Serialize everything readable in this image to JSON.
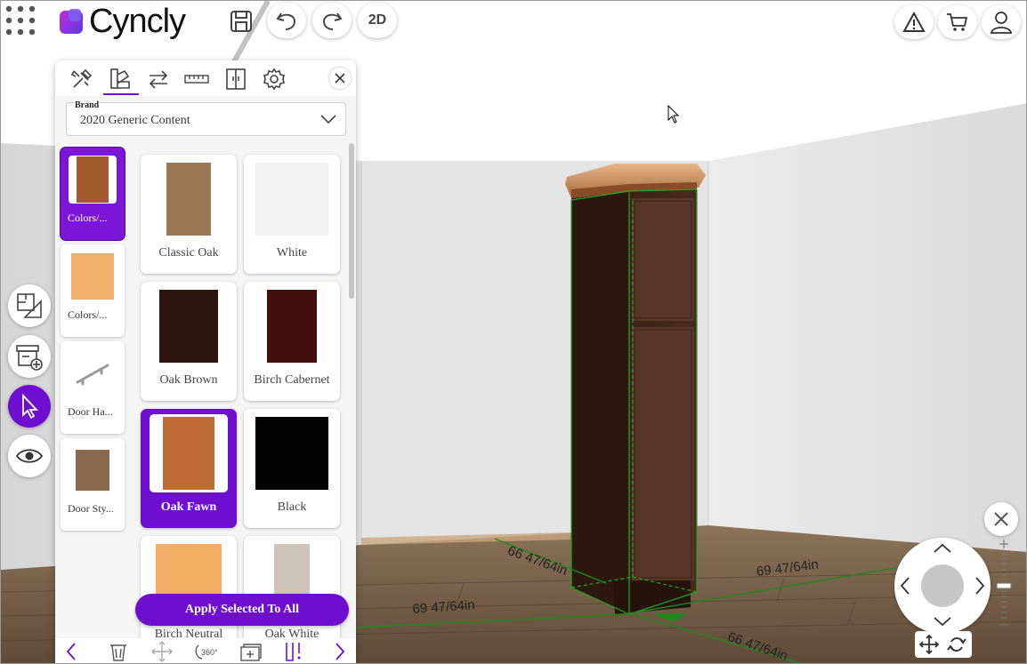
{
  "app": {
    "logo_text": "Cyncly"
  },
  "toolbar": {
    "view_2d_label": "2D"
  },
  "panel": {
    "brand_label": "Brand",
    "brand_value": "2020 Generic Content",
    "categories": [
      {
        "label": "Colors/...",
        "swatch_color": "#a15a2c"
      },
      {
        "label": "Colors/...",
        "swatch_color": "#f0b06c"
      },
      {
        "label": "Door Ha..."
      },
      {
        "label": "Door Sty...",
        "swatch_color": "#8a6a4e"
      }
    ],
    "swatches": [
      {
        "label": "Classic Oak",
        "color": "#9b7653"
      },
      {
        "label": "White",
        "color": "#f2f2f2"
      },
      {
        "label": "Oak Brown",
        "color": "#2b1510"
      },
      {
        "label": "Birch Cabernet",
        "color": "#44100e"
      },
      {
        "label": "Oak Fawn",
        "color": "#bf6d35"
      },
      {
        "label": "Black",
        "color": "#020202"
      },
      {
        "label": "Birch Neutral",
        "color": "#f5ad66"
      },
      {
        "label": "Oak White",
        "color": "#cdc4bb"
      }
    ],
    "apply_button": "Apply Selected To All"
  },
  "dimensions": {
    "depth_left": "66 47/64in",
    "width_bottom": "69 47/64in",
    "width_right": "69 47/64in",
    "depth_bottom": "66 47/64in"
  },
  "colors": {
    "accent": "#6e0fd0",
    "dimension_line": "#1e8a1e"
  }
}
